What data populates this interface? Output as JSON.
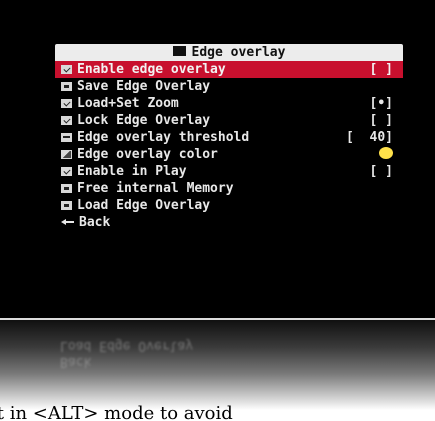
{
  "menu": {
    "title": "Edge overlay",
    "title_icon": "menu-icon",
    "items": [
      {
        "label": "Enable edge overlay",
        "icon": "checkbox-icon",
        "value": "[ ]",
        "selected": true
      },
      {
        "label": "Save Edge Overlay",
        "icon": "save-icon",
        "value": ""
      },
      {
        "label": "Load+Set Zoom",
        "icon": "checkbox-icon",
        "value": "[•]"
      },
      {
        "label": "Lock Edge Overlay",
        "icon": "checkbox-icon",
        "value": "[ ]"
      },
      {
        "label": "Edge overlay threshold",
        "icon": "slider-icon",
        "value": "[  40]"
      },
      {
        "label": "Edge overlay color",
        "icon": "palette-icon",
        "value": ""
      },
      {
        "label": "Enable in Play",
        "icon": "checkbox-icon",
        "value": "[ ]"
      },
      {
        "label": "Free internal Memory",
        "icon": "memory-icon",
        "value": ""
      },
      {
        "label": "Load Edge Overlay",
        "icon": "load-icon",
        "value": ""
      },
      {
        "label": "Back",
        "icon": "back-arrow-icon",
        "value": ""
      }
    ],
    "overlay_color": "#ffe14a",
    "selected_color": "#c8102e"
  },
  "caption": "it in <ALT> mode to avoid"
}
